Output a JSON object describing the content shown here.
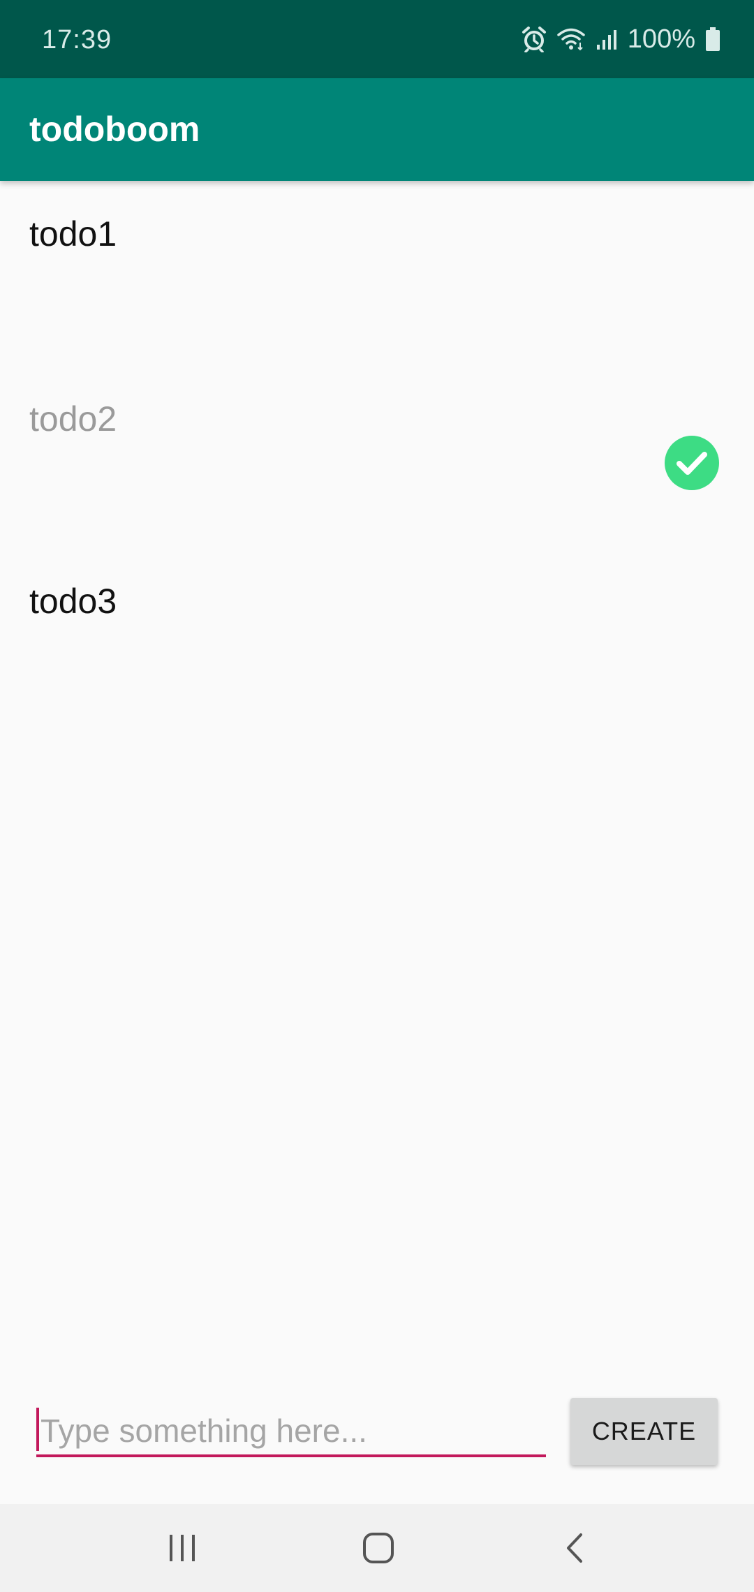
{
  "status_bar": {
    "time": "17:39",
    "battery_percent": "100%",
    "icons": [
      "alarm-icon",
      "wifi-icon",
      "signal-icon",
      "battery-icon"
    ]
  },
  "app_bar": {
    "title": "todoboom"
  },
  "todos": [
    {
      "label": "todo1",
      "done": false
    },
    {
      "label": "todo2",
      "done": true
    },
    {
      "label": "todo3",
      "done": false
    }
  ],
  "composer": {
    "input_value": "",
    "placeholder": "Type something here...",
    "create_label": "CREATE"
  },
  "nav_bar": {
    "buttons": [
      "recents-icon",
      "home-icon",
      "back-icon"
    ]
  },
  "colors": {
    "status_bar": "#00574b",
    "app_bar": "#008577",
    "accent": "#c2185b",
    "check": "#3ddc84"
  }
}
